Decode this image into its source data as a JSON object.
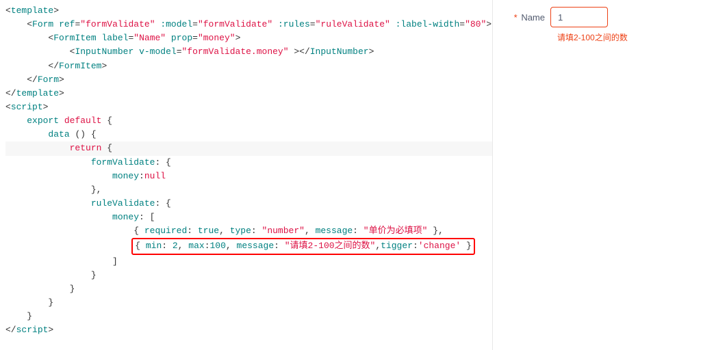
{
  "code": {
    "tags": {
      "template_open": "<template>",
      "template_close": "</template>",
      "form_open_a": "ref",
      "form_open_av1": "\"formValidate\"",
      "form_open_b": ":model",
      "form_open_av2": "\"formValidate\"",
      "form_open_c": ":rules",
      "form_open_av3": "\"ruleValidate\"",
      "form_open_d": ":label-width",
      "form_open_av4": "\"80\"",
      "formitem_a": "label",
      "formitem_av1": "\"Name\"",
      "formitem_b": "prop",
      "formitem_av2": "\"money\"",
      "inputnum_a": "v-model",
      "inputnum_av1": "\"formValidate.money\"",
      "script_open": "<script>",
      "script_close": "</script>"
    },
    "js": {
      "export": "export",
      "default": "default",
      "data": "data",
      "return": "return",
      "formValidate": "formValidate",
      "money": "money",
      "null": "null",
      "ruleValidate": "ruleValidate",
      "rule1_required": "required",
      "rule1_true": "true",
      "rule1_type": "type",
      "rule1_type_v": "\"number\"",
      "rule1_message": "message",
      "rule1_message_v": "\"单价为必填项\"",
      "rule2_min": "min",
      "rule2_min_v": "2",
      "rule2_max": "max",
      "rule2_max_v": "100",
      "rule2_message": "message",
      "rule2_message_v": "\"请填2-100之间的数\"",
      "rule2_tigger": "tigger",
      "rule2_tigger_v": "'change'"
    }
  },
  "form": {
    "label": "Name",
    "required_mark": "*",
    "value": "1",
    "error": "请填2-100之间的数"
  }
}
